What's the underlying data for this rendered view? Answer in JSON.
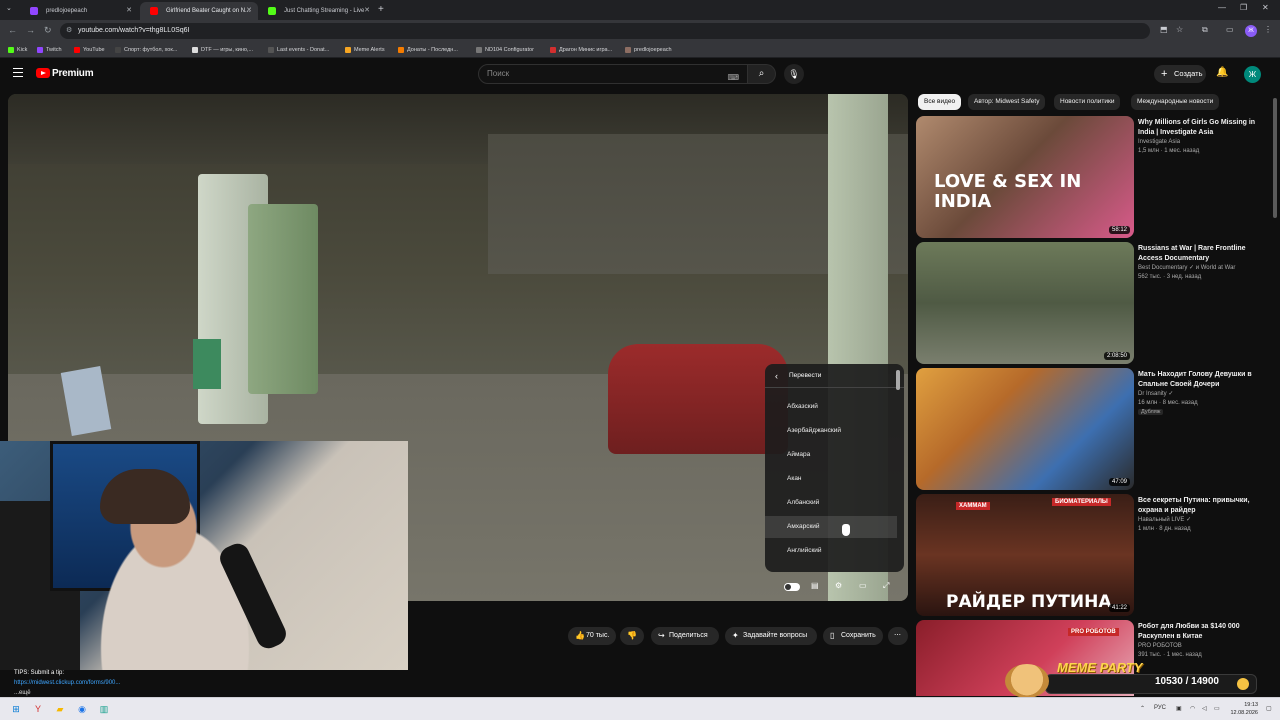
{
  "browser": {
    "tabs": [
      {
        "title": "predlojoepeach",
        "color": "#9146ff",
        "active": false
      },
      {
        "title": "Girlfriend Beater Caught on N...",
        "color": "#ff0000",
        "active": true
      },
      {
        "title": "Just Chatting Streaming - Live",
        "color": "#53fc18",
        "active": false
      }
    ],
    "url": "youtube.com/watch?v=thg8LL0Sq6I",
    "bookmarks": [
      {
        "label": "Kick",
        "color": "#53fc18"
      },
      {
        "label": "Twitch",
        "color": "#9146ff"
      },
      {
        "label": "YouTube",
        "color": "#ff0000"
      },
      {
        "label": "Спорт: футбол, хок...",
        "color": "#444444"
      },
      {
        "label": "DTF — игры, кино,...",
        "color": "#222222"
      },
      {
        "label": "Last events - Donat...",
        "color": "#555555"
      },
      {
        "label": "Meme Alerts",
        "color": "#f6a623"
      },
      {
        "label": "Донаты - Последн...",
        "color": "#f57c00"
      },
      {
        "label": "ND104 Configurator",
        "color": "#777777"
      },
      {
        "label": "Драгон Минис игра...",
        "color": "#d32f2f"
      },
      {
        "label": "predlojoepeach",
        "color": "#8d6e63"
      }
    ]
  },
  "youtube": {
    "logo_text": "Premium",
    "search_placeholder": "Поиск",
    "create_label": "Создать",
    "avatar_letter": "Ж"
  },
  "player_menu": {
    "header": "Перевести",
    "items": [
      "Абхазский",
      "Азербайджанский",
      "Аймара",
      "Акан",
      "Албанский",
      "Амхарский",
      "Английский"
    ],
    "hovered": "Амхарский"
  },
  "actions": {
    "likes": "70 тыс.",
    "share": "Поделиться",
    "ask": "Задавайте вопросы",
    "save": "Сохранить"
  },
  "tips": {
    "text": "TIPS: Submit a tip:",
    "link": "https://midwest.clickup.com/forms/900...",
    "more": "...ещё"
  },
  "chips": [
    "Все видео",
    "Автор: Midwest Safety",
    "Новости политики",
    "Международные новости"
  ],
  "recommendations": [
    {
      "title": "Why Millions of Girls Go Missing in India | Investigate Asia",
      "channel": "Investigate Asia",
      "stats": "1,5 млн · 1 мес. назад",
      "duration": "58:12",
      "caption": "LOVE & SEX IN INDIA"
    },
    {
      "title": "Russians at War | Rare Frontline Access Documentary",
      "channel": "Best Documentary ✓ и World at War",
      "stats": "562 тыс. · 3 нед. назад",
      "duration": "2:08:50"
    },
    {
      "title": "Мать Находит Голову Девушки в Спальне Своей Дочери",
      "channel": "Dr Insanity ✓",
      "stats": "16 млн · 8 мес. назад",
      "duration": "47:09",
      "badge": "Дубляж"
    },
    {
      "title": "Все секреты Путина: привычки, охрана и райдер",
      "channel": "Навальный LIVE ✓",
      "stats": "1 млн · 8 дн. назад",
      "duration": "41:22",
      "caption": "РАЙДЕР ПУТИНА",
      "tag_left": "ХАММАМ",
      "tag_right": "БИОМАТЕРИАЛЫ"
    },
    {
      "title": "Робот для Любви за $140 000 Раскуплен в Китае",
      "channel": "PRO РОБОТОВ",
      "stats": "391 тыс. · 1 мес. назад",
      "tag_right": "PRO РОБОТОВ"
    }
  ],
  "overlay": {
    "title": "MEME PARTY",
    "count": "10530 / 14900"
  },
  "taskbar": {
    "lang": "РУС",
    "time": "19:13",
    "date": "12.08.2026"
  }
}
